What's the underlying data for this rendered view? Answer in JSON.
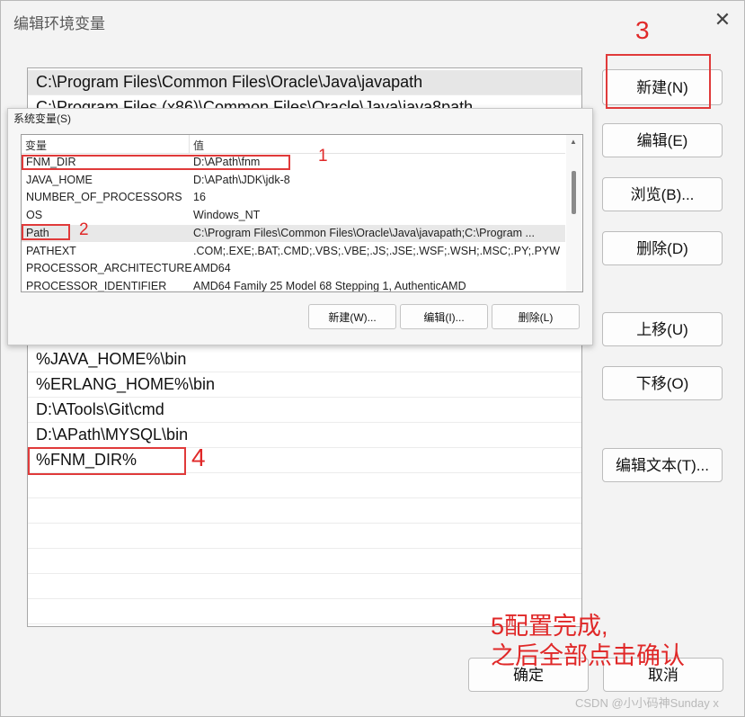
{
  "dialog": {
    "title": "编辑环境变量",
    "close_glyph": "✕",
    "path_entries": [
      "C:\\Program Files\\Common Files\\Oracle\\Java\\javapath",
      "C:\\Program Files (x86)\\Common Files\\Oracle\\Java\\java8path",
      "%JAVA_HOME%\\bin",
      "%ERLANG_HOME%\\bin",
      "D:\\ATools\\Git\\cmd",
      "D:\\APath\\MYSQL\\bin",
      "%FNM_DIR%"
    ],
    "buttons": {
      "new": "新建(N)",
      "edit": "编辑(E)",
      "browse": "浏览(B)...",
      "delete": "删除(D)",
      "move_up": "上移(U)",
      "move_down": "下移(O)",
      "edit_text": "编辑文本(T)...",
      "ok": "确定",
      "cancel": "取消"
    }
  },
  "system_vars": {
    "group_title": "系统变量(S)",
    "col_variable": "变量",
    "col_value": "值",
    "rows": [
      {
        "name": "FNM_DIR",
        "value": "D:\\APath\\fnm"
      },
      {
        "name": "JAVA_HOME",
        "value": "D:\\APath\\JDK\\jdk-8"
      },
      {
        "name": "NUMBER_OF_PROCESSORS",
        "value": "16"
      },
      {
        "name": "OS",
        "value": "Windows_NT"
      },
      {
        "name": "Path",
        "value": "C:\\Program Files\\Common Files\\Oracle\\Java\\javapath;C:\\Program ..."
      },
      {
        "name": "PATHEXT",
        "value": ".COM;.EXE;.BAT;.CMD;.VBS;.VBE;.JS;.JSE;.WSF;.WSH;.MSC;.PY;.PYW"
      },
      {
        "name": "PROCESSOR_ARCHITECTURE",
        "value": "AMD64"
      },
      {
        "name": "PROCESSOR_IDENTIFIER",
        "value": "AMD64 Family 25 Model 68 Stepping 1, AuthenticAMD"
      }
    ],
    "buttons": {
      "new": "新建(W)...",
      "edit": "编辑(I)...",
      "delete": "删除(L)"
    }
  },
  "annotations": {
    "n1": "1",
    "n2": "2",
    "n3": "3",
    "n4": "4",
    "n5_line1": "5配置完成,",
    "n5_line2": "之后全部点击确认",
    "color": "#e02828"
  },
  "watermark": "CSDN @小小码神Sunday x"
}
